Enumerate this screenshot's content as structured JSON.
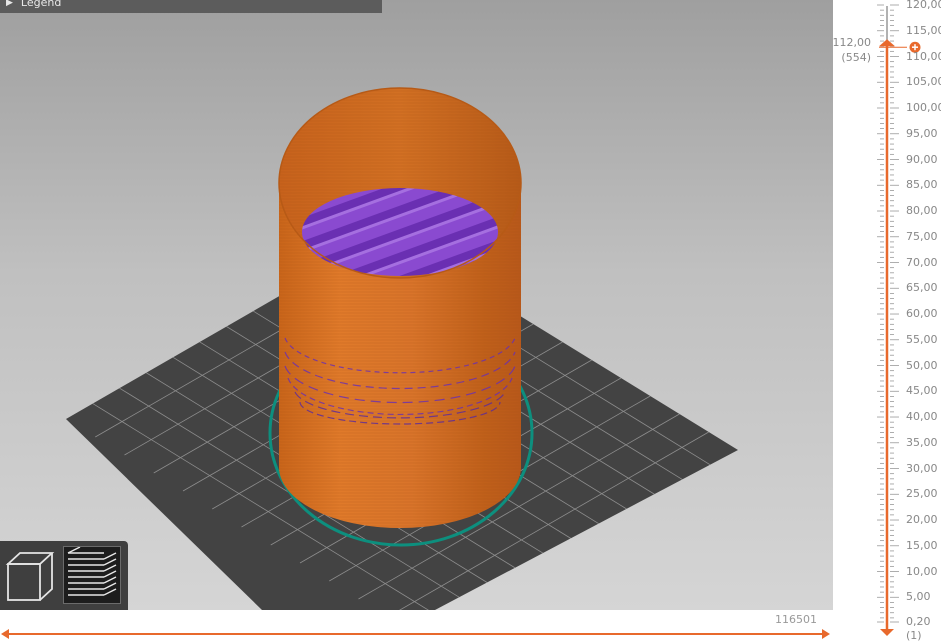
{
  "legend": {
    "label": "Legend",
    "icon": "triangle-right-icon"
  },
  "view_toggle": {
    "buttons": [
      {
        "name": "3d-view",
        "icon": "cube-icon",
        "active": false
      },
      {
        "name": "preview-layers",
        "icon": "layers-stack-icon",
        "active": true
      }
    ]
  },
  "layer_slider": {
    "ticks": [
      "120,00",
      "115,00",
      "110,00",
      "105,00",
      "100,00",
      "95,00",
      "90,00",
      "85,00",
      "80,00",
      "75,00",
      "70,00",
      "65,00",
      "60,00",
      "55,00",
      "50,00",
      "45,00",
      "40,00",
      "35,00",
      "30,00",
      "25,00",
      "20,00",
      "15,00",
      "10,00",
      "5,00",
      "0,20"
    ],
    "bottom_index": "(1)",
    "current_height": "112,00",
    "current_layer": "(554)",
    "accent": "#e8692c"
  },
  "horizontal_slider": {
    "move_count": "116501"
  },
  "colors": {
    "model": "#d5731f",
    "infill": "#8b4bd0",
    "skirt": "#0d8f7e",
    "bed": "#424242"
  }
}
